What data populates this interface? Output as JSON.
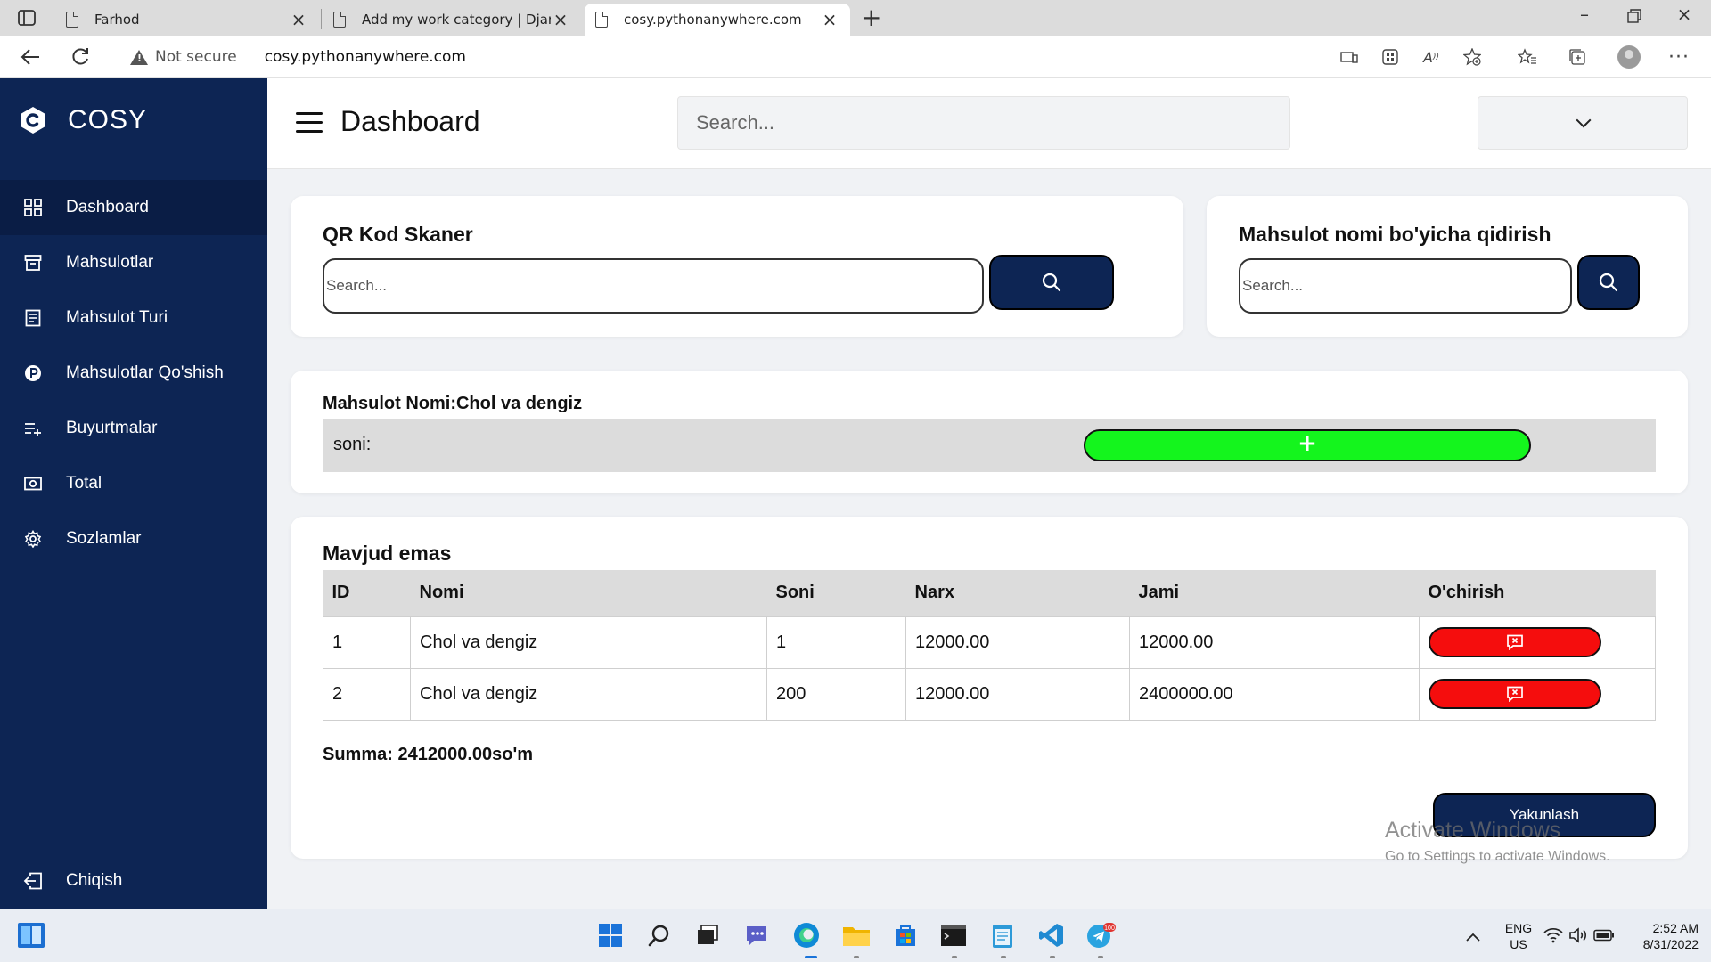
{
  "browser": {
    "tabs": [
      {
        "title": "Farhod"
      },
      {
        "title": "Add my work category | Django"
      },
      {
        "title": "cosy.pythonanywhere.com"
      }
    ],
    "security_label": "Not secure",
    "url": "cosy.pythonanywhere.com"
  },
  "sidebar": {
    "brand": "COSY",
    "items": [
      {
        "label": "Dashboard",
        "icon": "grid-icon"
      },
      {
        "label": "Mahsulotlar",
        "icon": "archive-icon"
      },
      {
        "label": "Mahsulot Turi",
        "icon": "receipt-icon"
      },
      {
        "label": "Mahsulotlar Qo'shish",
        "icon": "p-circle-icon"
      },
      {
        "label": "Buyurtmalar",
        "icon": "playlist-add-icon"
      },
      {
        "label": "Total",
        "icon": "money-icon"
      },
      {
        "label": "Sozlamlar",
        "icon": "gear-icon"
      }
    ],
    "logout": "Chiqish"
  },
  "header": {
    "title": "Dashboard",
    "search_placeholder": "Search..."
  },
  "qr_card": {
    "title": "QR Kod Skaner",
    "placeholder": "Search..."
  },
  "name_search_card": {
    "title": "Mahsulot nomi bo'yicha qidirish",
    "placeholder": "Search..."
  },
  "product_card": {
    "title": "Mahsulot Nomi:Chol va dengiz",
    "quantity_label": "soni:",
    "add_label": "+"
  },
  "orders_card": {
    "title": "Mavjud emas",
    "columns": [
      "ID",
      "Nomi",
      "Soni",
      "Narx",
      "Jami",
      "O'chirish"
    ],
    "rows": [
      {
        "id": "1",
        "name": "Chol va dengiz",
        "qty": "1",
        "price": "12000.00",
        "total": "12000.00"
      },
      {
        "id": "2",
        "name": "Chol va dengiz",
        "qty": "200",
        "price": "12000.00",
        "total": "2400000.00"
      }
    ],
    "summa": "Summa: 2412000.00so'm",
    "finish_label": "Yakunlash"
  },
  "watermark": {
    "line1": "Activate Windows",
    "line2": "Go to Settings to activate Windows."
  },
  "taskbar": {
    "lang": "ENG",
    "region": "US",
    "time": "2:52 AM",
    "date": "8/31/2022",
    "telegram_badge": "100"
  },
  "colors": {
    "sidebar": "#0d2554",
    "accent_blue": "#1b9cf0",
    "add_green": "#14f51d",
    "delete_red": "#f50d0d"
  }
}
